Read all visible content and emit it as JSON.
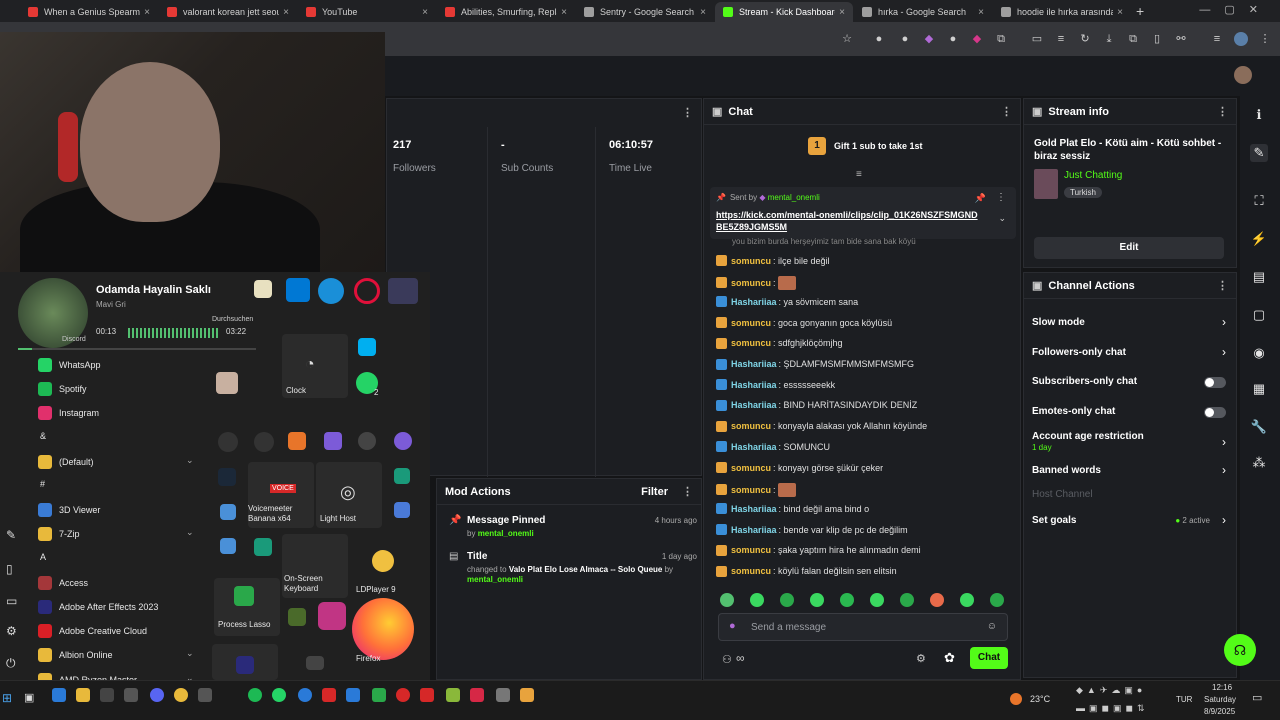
{
  "tabs": [
    {
      "title": "When a Genius Spearman...",
      "color": "#e53935",
      "active": false
    },
    {
      "title": "valorant korean jett seoul...",
      "color": "#e53935",
      "active": false
    },
    {
      "title": "YouTube",
      "color": "#e53935",
      "active": false
    },
    {
      "title": "Abilities, Smurfing, Replay...",
      "color": "#e53935",
      "active": false
    },
    {
      "title": "Sentry - Google Search",
      "color": "#9e9e9e",
      "active": false
    },
    {
      "title": "Stream - Kick Dashboard",
      "color": "#53fc18",
      "active": true
    },
    {
      "title": "hırka - Google Search",
      "color": "#9e9e9e",
      "active": false
    },
    {
      "title": "hoodie ile hırka arasındaki...",
      "color": "#9e9e9e",
      "active": false
    }
  ],
  "tab_close": "×",
  "new_tab": "+",
  "stats": {
    "followers_value": "217",
    "followers_label": "Followers",
    "subs_value": "-",
    "subs_label": "Sub Counts",
    "time_value": "06:10:57",
    "time_label": "Time Live"
  },
  "chat": {
    "title": "Chat",
    "gift_badge": "1",
    "gift_text": "Gift 1 sub to take 1st",
    "pinned_sent_by": "Sent by",
    "pinned_user": "mental_onemli",
    "pinned_link": "https://kick.com/mental-onemli/clips/clip_01K26NSZFSMGNDBE5Z89JGMS5M",
    "partial_top": "you bizim burda herşeyimiz tam bide sana bak köyü",
    "messages": [
      {
        "badge": "crown",
        "user": "somuncu",
        "text": "ilçe bile değil",
        "emote": false
      },
      {
        "badge": "crown",
        "user": "somuncu",
        "text": "",
        "emote": true
      },
      {
        "badge": "bolt",
        "user": "Hashariiaa",
        "text": "ya sövmicem sana",
        "emote": false
      },
      {
        "badge": "crown",
        "user": "somuncu",
        "text": "goca gonyanın goca köylüsü",
        "emote": false
      },
      {
        "badge": "crown",
        "user": "somuncu",
        "text": "sdfghjklöçömjhg",
        "emote": false
      },
      {
        "badge": "bolt",
        "user": "Hashariiaa",
        "text": "ŞDLAMFMSMFMMSMFMSMFG",
        "emote": false
      },
      {
        "badge": "bolt",
        "user": "Hashariiaa",
        "text": "essssseeekk",
        "emote": false
      },
      {
        "badge": "bolt",
        "user": "Hashariiaa",
        "text": "BIND HARİTASINDAYDIK DENİZ",
        "emote": false
      },
      {
        "badge": "crown",
        "user": "somuncu",
        "text": "konyayla alakası yok Allahın köyünde",
        "emote": false
      },
      {
        "badge": "bolt",
        "user": "Hashariiaa",
        "text": "SOMUNCU",
        "emote": false
      },
      {
        "badge": "crown",
        "user": "somuncu",
        "text": "konyayı görse şükür çeker",
        "emote": false
      },
      {
        "badge": "crown",
        "user": "somuncu",
        "text": "",
        "emote": true
      },
      {
        "badge": "bolt",
        "user": "Hashariiaa",
        "text": "bind değil ama bind o",
        "emote": false
      },
      {
        "badge": "bolt",
        "user": "Hashariiaa",
        "text": "bende var klip de pc de değilim",
        "emote": false
      },
      {
        "badge": "crown",
        "user": "somuncu",
        "text": "şaka yaptım hira he alınmadın demi",
        "emote": false
      },
      {
        "badge": "crown",
        "user": "somuncu",
        "text": "köylü falan değilsin sen elitsin",
        "emote": false
      }
    ],
    "input_placeholder": "Send a message",
    "send_label": "Chat",
    "infinity": "∞"
  },
  "stream_info": {
    "title": "Stream info",
    "stream_title": "Gold Plat Elo - Kötü aim - Kötü sohbet - biraz sessiz",
    "category": "Just Chatting",
    "language": "Turkish",
    "edit_label": "Edit"
  },
  "channel_actions": {
    "title": "Channel Actions",
    "items": [
      {
        "label": "Slow mode",
        "control": "chevron"
      },
      {
        "label": "Followers-only chat",
        "control": "chevron"
      },
      {
        "label": "Subscribers-only chat",
        "control": "toggle"
      },
      {
        "label": "Emotes-only chat",
        "control": "toggle"
      },
      {
        "label": "Account age restriction",
        "control": "chevron",
        "sub": "1 day"
      },
      {
        "label": "Banned words",
        "control": "chevron"
      },
      {
        "label": "Host Channel",
        "control": "none",
        "disabled": true
      },
      {
        "label": "Set goals",
        "control": "chevron",
        "badge": "2 active"
      }
    ]
  },
  "mod_actions": {
    "title": "Mod Actions",
    "filter_label": "Filter",
    "items": [
      {
        "title": "Message Pinned",
        "by": "by",
        "user": "mental_onemli",
        "time": "4 hours ago"
      },
      {
        "title": "Title",
        "changed": "changed to",
        "value": "Valo Plat Elo Lose Almaca -- Solo Queue",
        "by": "by",
        "user": "mental_onemli",
        "time": "1 day ago"
      }
    ]
  },
  "media": {
    "title": "Odamda Hayalin Saklı",
    "artist": "Mavi Gri",
    "elapsed": "00:13",
    "total": "03:22",
    "progress": 0.06,
    "overlay_a": "Durchsuchen",
    "overlay_b": "Discord"
  },
  "start_menu": {
    "apps": [
      {
        "label": "WhatsApp",
        "color": "#25d366"
      },
      {
        "label": "Spotify",
        "color": "#1db954"
      },
      {
        "label": "Instagram",
        "color": "#e1306c"
      },
      {
        "label": "&",
        "color": "",
        "header": true
      },
      {
        "label": "(Default)",
        "color": "#e8b93b",
        "folder": true
      },
      {
        "label": "#",
        "color": "",
        "header": true
      },
      {
        "label": "3D Viewer",
        "color": "#3a7bd5"
      },
      {
        "label": "7-Zip",
        "color": "#e8b93b",
        "folder": true
      },
      {
        "label": "A",
        "color": "",
        "header": true
      },
      {
        "label": "Access",
        "color": "#a4373a"
      },
      {
        "label": "Adobe After Effects 2023",
        "color": "#2a2a7a"
      },
      {
        "label": "Adobe Creative Cloud",
        "color": "#da1f26"
      },
      {
        "label": "Albion Online",
        "color": "#e8b93b",
        "folder": true
      },
      {
        "label": "AMD Ryzen Master",
        "color": "#e8b93b",
        "folder": true
      }
    ],
    "tiles": {
      "clock": "Clock",
      "voicemeeter": "Voicemeeter Banana x64",
      "voice_badge": "VOICE",
      "light_host": "Light Host",
      "onscreen": "On-Screen Keyboard",
      "ldplayer": "LDPlayer 9",
      "process_lasso": "Process Lasso",
      "firefox": "Firefox",
      "whatsapp_badge": "2"
    }
  },
  "taskbar": {
    "weather": "23°C",
    "lang": "TUR",
    "time": "12:16",
    "day": "Saturday",
    "date": "8/9/2025"
  }
}
